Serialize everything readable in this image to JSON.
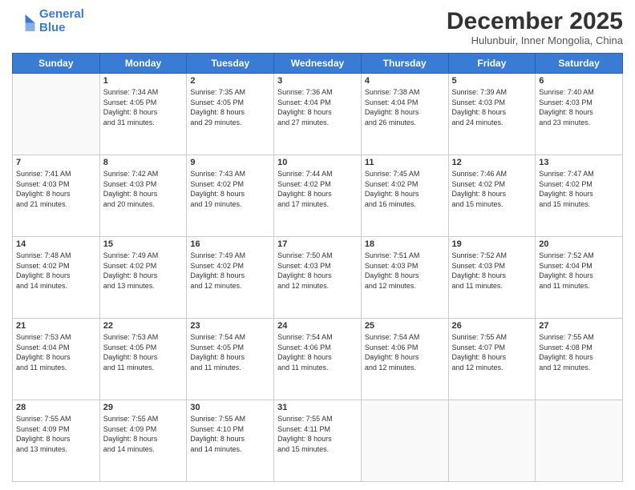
{
  "header": {
    "logo_line1": "General",
    "logo_line2": "Blue",
    "month": "December 2025",
    "location": "Hulunbuir, Inner Mongolia, China"
  },
  "days_of_week": [
    "Sunday",
    "Monday",
    "Tuesday",
    "Wednesday",
    "Thursday",
    "Friday",
    "Saturday"
  ],
  "weeks": [
    [
      {
        "day": "",
        "info": ""
      },
      {
        "day": "1",
        "info": "Sunrise: 7:34 AM\nSunset: 4:05 PM\nDaylight: 8 hours\nand 31 minutes."
      },
      {
        "day": "2",
        "info": "Sunrise: 7:35 AM\nSunset: 4:05 PM\nDaylight: 8 hours\nand 29 minutes."
      },
      {
        "day": "3",
        "info": "Sunrise: 7:36 AM\nSunset: 4:04 PM\nDaylight: 8 hours\nand 27 minutes."
      },
      {
        "day": "4",
        "info": "Sunrise: 7:38 AM\nSunset: 4:04 PM\nDaylight: 8 hours\nand 26 minutes."
      },
      {
        "day": "5",
        "info": "Sunrise: 7:39 AM\nSunset: 4:03 PM\nDaylight: 8 hours\nand 24 minutes."
      },
      {
        "day": "6",
        "info": "Sunrise: 7:40 AM\nSunset: 4:03 PM\nDaylight: 8 hours\nand 23 minutes."
      }
    ],
    [
      {
        "day": "7",
        "info": "Sunrise: 7:41 AM\nSunset: 4:03 PM\nDaylight: 8 hours\nand 21 minutes."
      },
      {
        "day": "8",
        "info": "Sunrise: 7:42 AM\nSunset: 4:03 PM\nDaylight: 8 hours\nand 20 minutes."
      },
      {
        "day": "9",
        "info": "Sunrise: 7:43 AM\nSunset: 4:02 PM\nDaylight: 8 hours\nand 19 minutes."
      },
      {
        "day": "10",
        "info": "Sunrise: 7:44 AM\nSunset: 4:02 PM\nDaylight: 8 hours\nand 17 minutes."
      },
      {
        "day": "11",
        "info": "Sunrise: 7:45 AM\nSunset: 4:02 PM\nDaylight: 8 hours\nand 16 minutes."
      },
      {
        "day": "12",
        "info": "Sunrise: 7:46 AM\nSunset: 4:02 PM\nDaylight: 8 hours\nand 15 minutes."
      },
      {
        "day": "13",
        "info": "Sunrise: 7:47 AM\nSunset: 4:02 PM\nDaylight: 8 hours\nand 15 minutes."
      }
    ],
    [
      {
        "day": "14",
        "info": "Sunrise: 7:48 AM\nSunset: 4:02 PM\nDaylight: 8 hours\nand 14 minutes."
      },
      {
        "day": "15",
        "info": "Sunrise: 7:49 AM\nSunset: 4:02 PM\nDaylight: 8 hours\nand 13 minutes."
      },
      {
        "day": "16",
        "info": "Sunrise: 7:49 AM\nSunset: 4:02 PM\nDaylight: 8 hours\nand 12 minutes."
      },
      {
        "day": "17",
        "info": "Sunrise: 7:50 AM\nSunset: 4:03 PM\nDaylight: 8 hours\nand 12 minutes."
      },
      {
        "day": "18",
        "info": "Sunrise: 7:51 AM\nSunset: 4:03 PM\nDaylight: 8 hours\nand 12 minutes."
      },
      {
        "day": "19",
        "info": "Sunrise: 7:52 AM\nSunset: 4:03 PM\nDaylight: 8 hours\nand 11 minutes."
      },
      {
        "day": "20",
        "info": "Sunrise: 7:52 AM\nSunset: 4:04 PM\nDaylight: 8 hours\nand 11 minutes."
      }
    ],
    [
      {
        "day": "21",
        "info": "Sunrise: 7:53 AM\nSunset: 4:04 PM\nDaylight: 8 hours\nand 11 minutes."
      },
      {
        "day": "22",
        "info": "Sunrise: 7:53 AM\nSunset: 4:05 PM\nDaylight: 8 hours\nand 11 minutes."
      },
      {
        "day": "23",
        "info": "Sunrise: 7:54 AM\nSunset: 4:05 PM\nDaylight: 8 hours\nand 11 minutes."
      },
      {
        "day": "24",
        "info": "Sunrise: 7:54 AM\nSunset: 4:06 PM\nDaylight: 8 hours\nand 11 minutes."
      },
      {
        "day": "25",
        "info": "Sunrise: 7:54 AM\nSunset: 4:06 PM\nDaylight: 8 hours\nand 12 minutes."
      },
      {
        "day": "26",
        "info": "Sunrise: 7:55 AM\nSunset: 4:07 PM\nDaylight: 8 hours\nand 12 minutes."
      },
      {
        "day": "27",
        "info": "Sunrise: 7:55 AM\nSunset: 4:08 PM\nDaylight: 8 hours\nand 12 minutes."
      }
    ],
    [
      {
        "day": "28",
        "info": "Sunrise: 7:55 AM\nSunset: 4:09 PM\nDaylight: 8 hours\nand 13 minutes."
      },
      {
        "day": "29",
        "info": "Sunrise: 7:55 AM\nSunset: 4:09 PM\nDaylight: 8 hours\nand 14 minutes."
      },
      {
        "day": "30",
        "info": "Sunrise: 7:55 AM\nSunset: 4:10 PM\nDaylight: 8 hours\nand 14 minutes."
      },
      {
        "day": "31",
        "info": "Sunrise: 7:55 AM\nSunset: 4:11 PM\nDaylight: 8 hours\nand 15 minutes."
      },
      {
        "day": "",
        "info": ""
      },
      {
        "day": "",
        "info": ""
      },
      {
        "day": "",
        "info": ""
      }
    ]
  ]
}
